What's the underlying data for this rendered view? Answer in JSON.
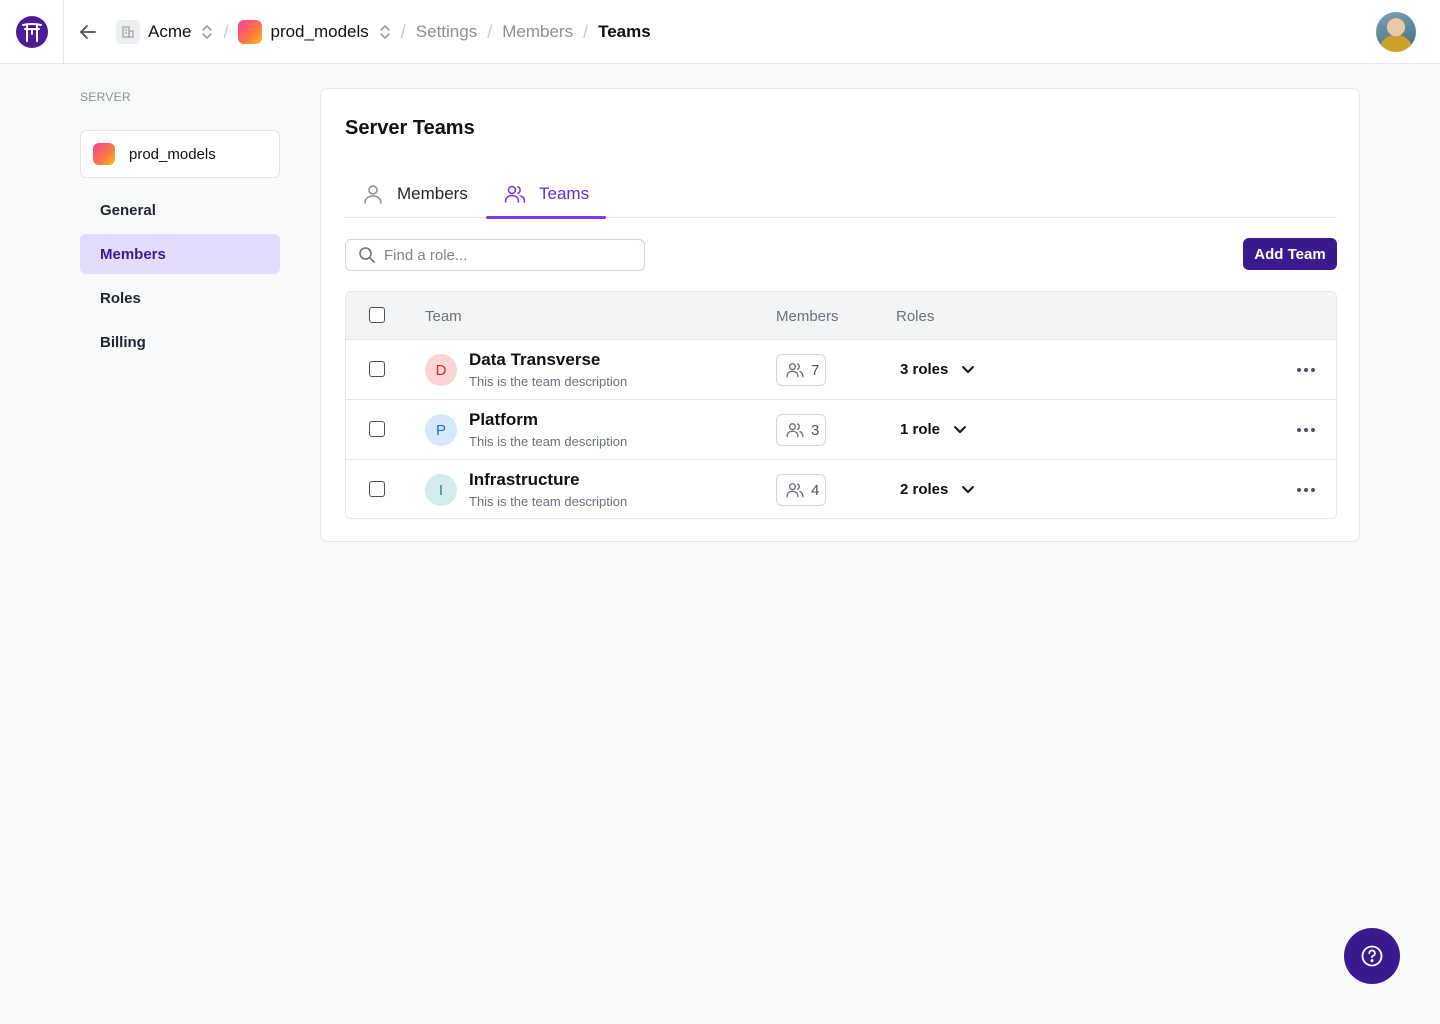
{
  "breadcrumb": {
    "org": "Acme",
    "server": "prod_models",
    "settings": "Settings",
    "members": "Members",
    "current": "Teams",
    "separator": "/"
  },
  "sidebar": {
    "heading": "SERVER",
    "server_name": "prod_models",
    "items": [
      {
        "label": "General",
        "active": false
      },
      {
        "label": "Members",
        "active": true
      },
      {
        "label": "Roles",
        "active": false
      },
      {
        "label": "Billing",
        "active": false
      }
    ]
  },
  "main": {
    "title": "Server Teams",
    "tabs": [
      {
        "label": "Members",
        "icon": "user-icon",
        "active": false
      },
      {
        "label": "Teams",
        "icon": "users-icon",
        "active": true
      }
    ],
    "search": {
      "placeholder": "Find a role...",
      "value": ""
    },
    "add_button": "Add Team"
  },
  "table": {
    "columns": [
      "Team",
      "Members",
      "Roles"
    ],
    "rows": [
      {
        "initial": "D",
        "name": "Data Transverse",
        "description": "This is the team description",
        "members": "7",
        "roles": "3 roles",
        "avatar_bg": "#fbd5d5",
        "avatar_fg": "#dc2626"
      },
      {
        "initial": "P",
        "name": "Platform",
        "description": "This is the team description",
        "members": "3",
        "roles": "1 role",
        "avatar_bg": "#d6e9fb",
        "avatar_fg": "#1d6fd6"
      },
      {
        "initial": "I",
        "name": "Infrastructure",
        "description": "This is the team description",
        "members": "4",
        "roles": "2 roles",
        "avatar_bg": "#d5ecef",
        "avatar_fg": "#1f8a99"
      }
    ]
  },
  "colors": {
    "accent": "#7c3aed",
    "primary_button": "#3b1a8f",
    "active_nav_bg": "#e3dcfb"
  }
}
